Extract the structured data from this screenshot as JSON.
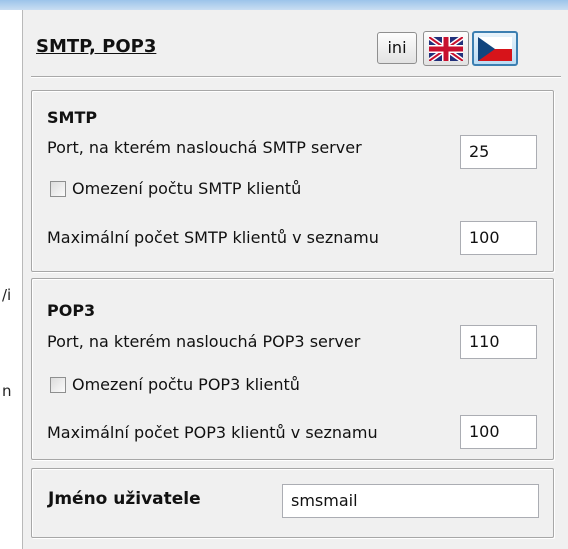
{
  "header": {
    "title": "SMTP, POP3",
    "ini_label": "ini",
    "flag_en_icon": "uk-flag-icon",
    "flag_cz_icon": "czech-flag-icon"
  },
  "left_fragments": [
    "/i",
    "n"
  ],
  "smtp": {
    "title": "SMTP",
    "port_label": "Port, na kterém naslouchá SMTP server",
    "port_value": "25",
    "limit_label": "Omezení počtu SMTP klientů",
    "limit_checked": false,
    "max_label": "Maximální počet SMTP klientů v seznamu",
    "max_value": "100"
  },
  "pop3": {
    "title": "POP3",
    "port_label": "Port, na kterém naslouchá POP3 server",
    "port_value": "110",
    "limit_label": "Omezení počtu POP3 klientů",
    "limit_checked": false,
    "max_label": "Maximální počet POP3 klientů v seznamu",
    "max_value": "100"
  },
  "user": {
    "label": "Jméno uživatele",
    "value": "smsmail"
  }
}
